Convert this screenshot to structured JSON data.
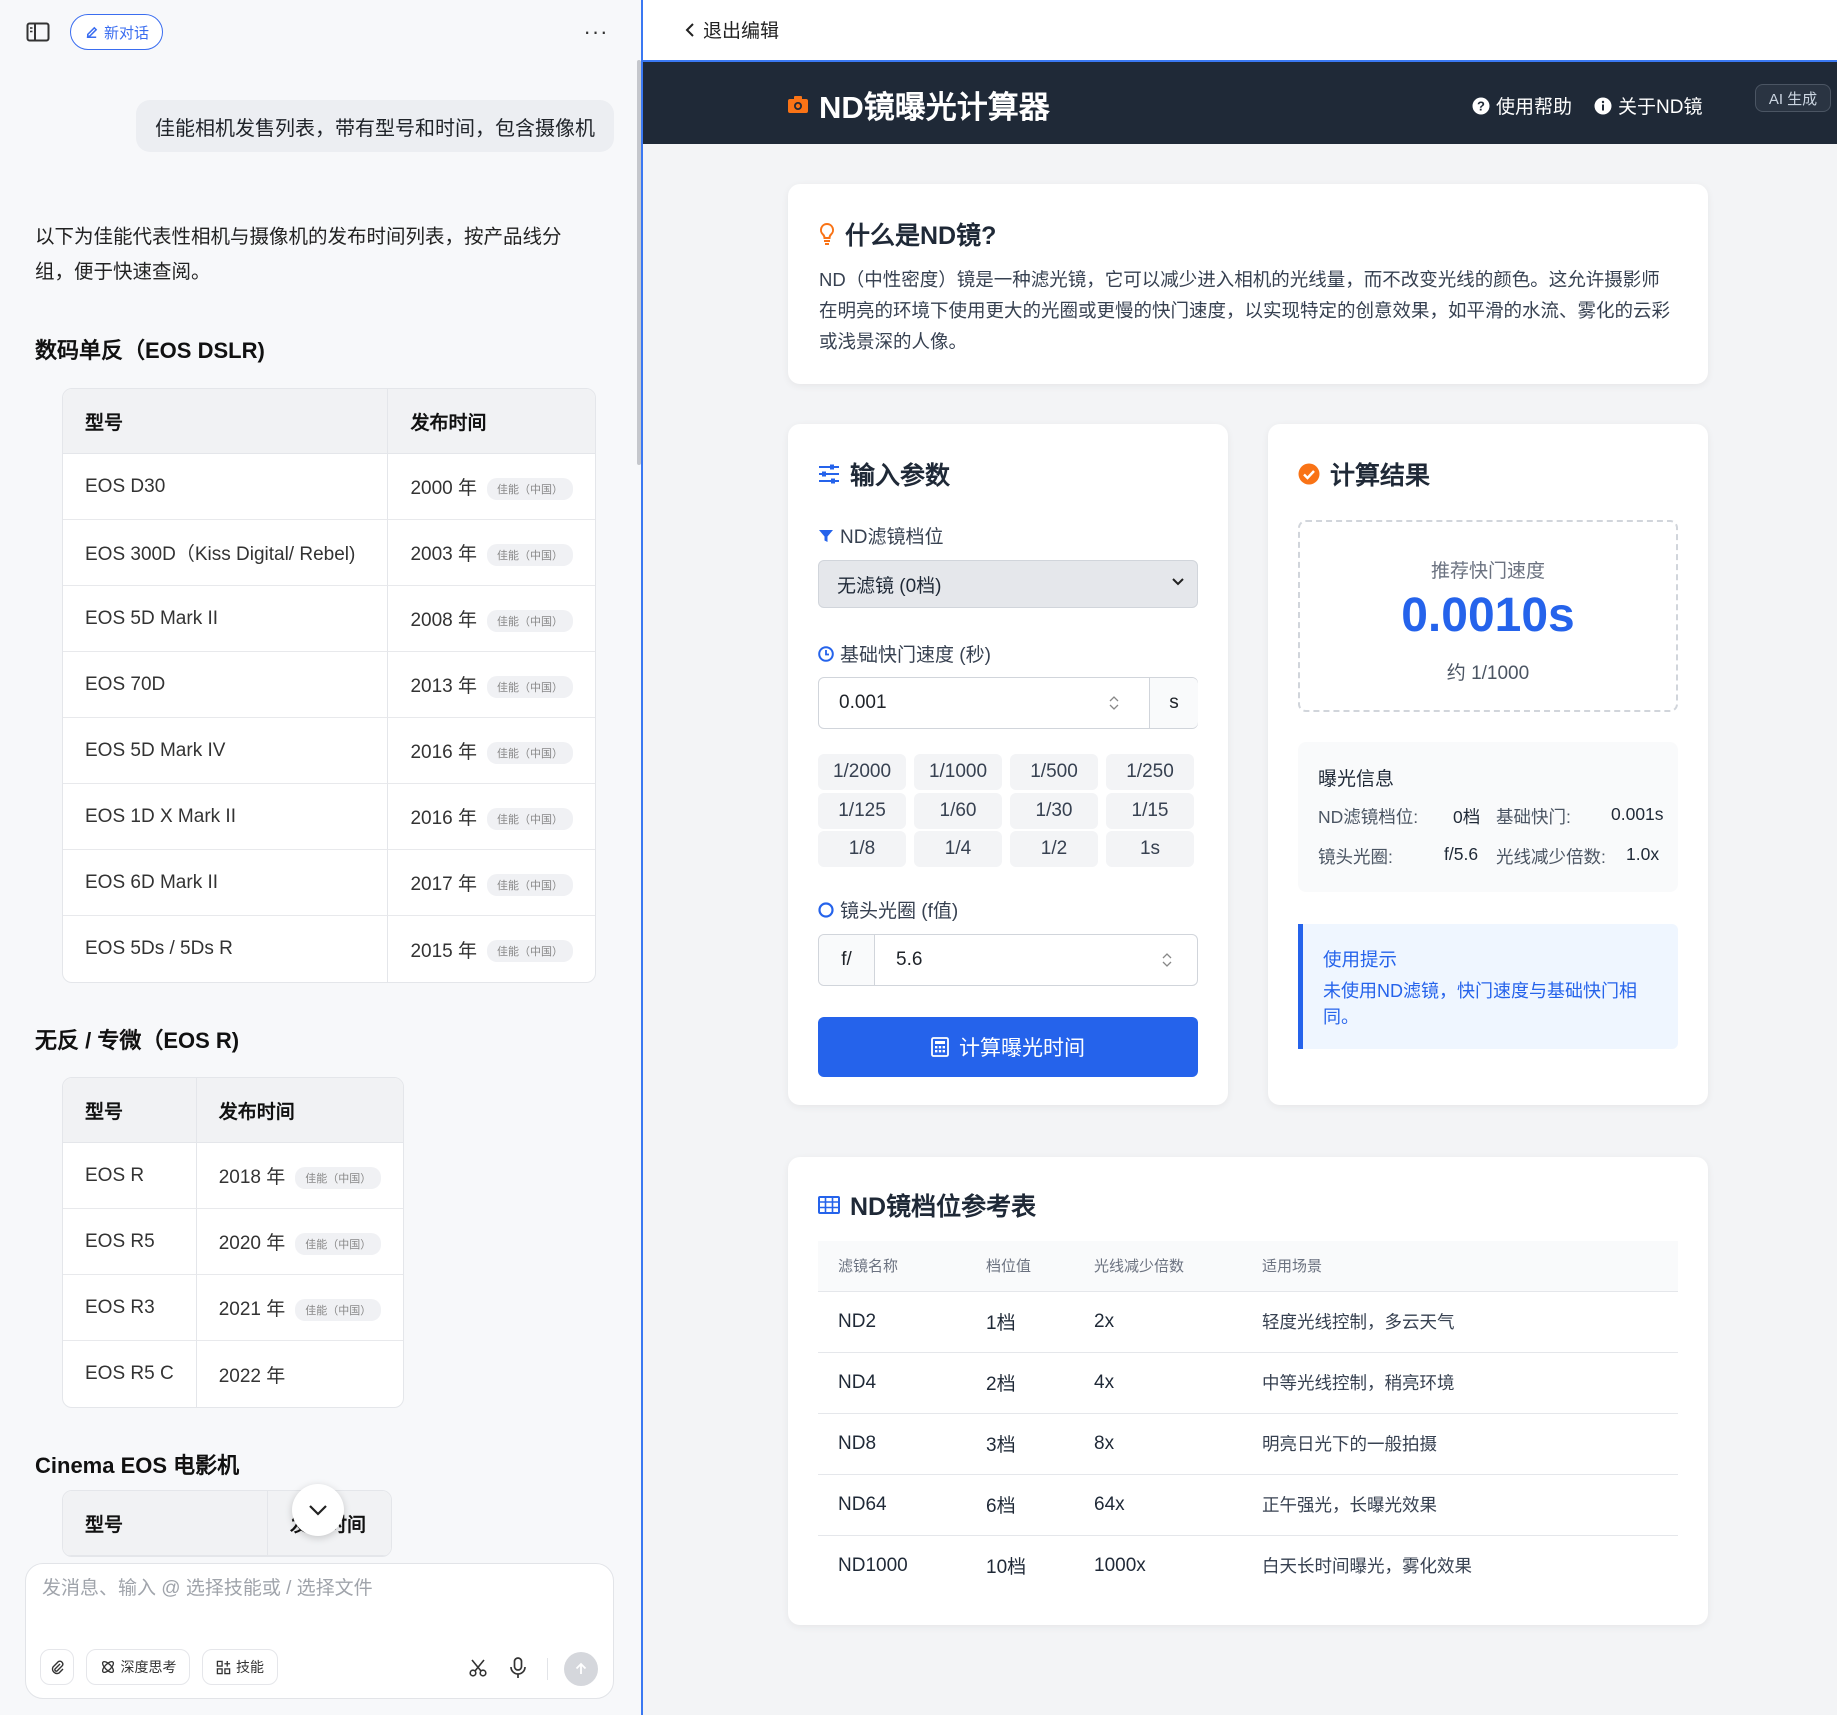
{
  "left": {
    "new_chat": "新对话",
    "user_message": "佳能相机发售列表，带有型号和时间，包含摄像机",
    "intro": "以下为佳能代表性相机与摄像机的发布时间列表，按产品线分组，便于快速查阅。",
    "sections": [
      {
        "title": "数码单反（EOS DSLR)",
        "headers": [
          "型号",
          "发布时间"
        ],
        "rows": [
          {
            "model": "EOS D30",
            "year": "2000 年",
            "tag": "佳能（中国）"
          },
          {
            "model": "EOS 300D（Kiss Digital/ Rebel)",
            "year": "2003 年",
            "tag": "佳能（中国）"
          },
          {
            "model": "EOS 5D Mark II",
            "year": "2008 年",
            "tag": "佳能（中国）"
          },
          {
            "model": "EOS 70D",
            "year": "2013 年",
            "tag": "佳能（中国）"
          },
          {
            "model": "EOS 5D Mark IV",
            "year": "2016 年",
            "tag": "佳能（中国）"
          },
          {
            "model": "EOS 1D X Mark II",
            "year": "2016 年",
            "tag": "佳能（中国）"
          },
          {
            "model": "EOS 6D Mark II",
            "year": "2017 年",
            "tag": "佳能（中国）"
          },
          {
            "model": "EOS 5Ds / 5Ds R",
            "year": "2015 年",
            "tag": "佳能（中国）"
          }
        ]
      },
      {
        "title": "无反 / 专微（EOS R)",
        "headers": [
          "型号",
          "发布时间"
        ],
        "rows": [
          {
            "model": "EOS R",
            "year": "2018 年",
            "tag": "佳能（中国）"
          },
          {
            "model": "EOS R5",
            "year": "2020 年",
            "tag": "佳能（中国）"
          },
          {
            "model": "EOS R3",
            "year": "2021 年",
            "tag": "佳能（中国）"
          },
          {
            "model": "EOS R5 C",
            "year": "2022 年",
            "tag": ""
          }
        ]
      },
      {
        "title": "Cinema EOS 电影机",
        "headers": [
          "型号",
          "发布时间"
        ],
        "rows": []
      }
    ],
    "composer": {
      "placeholder": "发消息、输入 @ 选择技能或 / 选择文件",
      "deep_think": "深度思考",
      "skills": "技能"
    }
  },
  "right": {
    "exit_edit": "退出编辑",
    "app_title": "ND镜曝光计算器",
    "nav": {
      "help": "使用帮助",
      "about": "关于ND镜"
    },
    "ai_badge": "AI 生成",
    "what": {
      "title": "什么是ND镜?",
      "text": "ND（中性密度）镜是一种滤光镜，它可以减少进入相机的光线量，而不改变光线的颜色。这允许摄影师在明亮的环境下使用更大的光圈或更慢的快门速度，以实现特定的创意效果，如平滑的水流、雾化的云彩或浅景深的人像。"
    },
    "inputs": {
      "title": "输入参数",
      "nd_label": "ND滤镜档位",
      "nd_value": "无滤镜 (0档)",
      "shutter_label": "基础快门速度 (秒)",
      "shutter_value": "0.001",
      "shutter_unit": "s",
      "presets": [
        "1/2000",
        "1/1000",
        "1/500",
        "1/250",
        "1/125",
        "1/60",
        "1/30",
        "1/15",
        "1/8",
        "1/4",
        "1/2",
        "1s"
      ],
      "aperture_label": "镜头光圈 (f值)",
      "aperture_prefix": "f/",
      "aperture_value": "5.6",
      "calc_button": "计算曝光时间"
    },
    "result": {
      "title": "计算结果",
      "rec_label": "推荐快门速度",
      "rec_value": "0.0010s",
      "rec_approx": "约 1/1000",
      "info_title": "曝光信息",
      "info": {
        "nd_k": "ND滤镜档位:",
        "nd_v": "0档",
        "base_k": "基础快门:",
        "base_v": "0.001s",
        "ap_k": "镜头光圈:",
        "ap_v": "f/5.6",
        "red_k": "光线减少倍数:",
        "red_v": "1.0x"
      },
      "tip_title": "使用提示",
      "tip_text": "未使用ND滤镜，快门速度与基础快门相同。"
    },
    "reference": {
      "title": "ND镜档位参考表",
      "headers": [
        "滤镜名称",
        "档位值",
        "光线减少倍数",
        "适用场景"
      ],
      "rows": [
        [
          "ND2",
          "1档",
          "2x",
          "轻度光线控制，多云天气"
        ],
        [
          "ND4",
          "2档",
          "4x",
          "中等光线控制，稍亮环境"
        ],
        [
          "ND8",
          "3档",
          "8x",
          "明亮日光下的一般拍摄"
        ],
        [
          "ND64",
          "6档",
          "64x",
          "正午强光，长曝光效果"
        ],
        [
          "ND1000",
          "10档",
          "1000x",
          "白天长时间曝光，雾化效果"
        ]
      ]
    }
  },
  "colors": {
    "accent": "#2563eb",
    "header_bg": "#1f2937",
    "orange": "#f97316"
  }
}
